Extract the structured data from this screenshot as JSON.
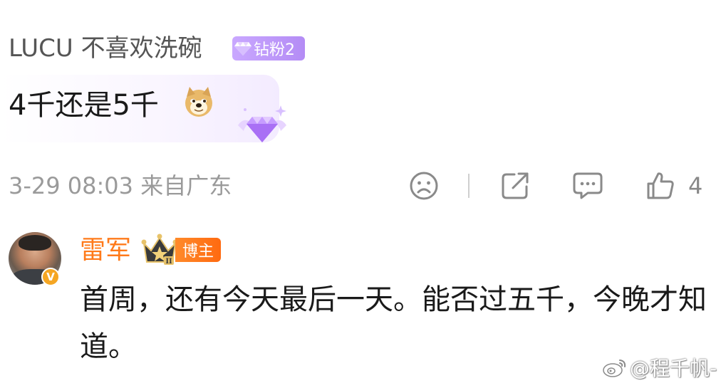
{
  "comment1": {
    "username": "LUCU 不喜欢洗碗",
    "badge_label": "钻粉2",
    "text": "4千还是5千",
    "timestamp": "3-29 08:03",
    "location": "来自广东",
    "like_count": "4",
    "icons": [
      "dislike-icon",
      "share-icon",
      "comment-icon",
      "like-icon"
    ]
  },
  "comment2": {
    "username": "雷军",
    "badge_label": "博主",
    "crown_level": "II",
    "verified_mark": "V",
    "text": "首周，还有今天最后一天。能否过五千，今晚才知道。"
  },
  "watermark": {
    "text": "@程千帆-"
  },
  "colors": {
    "accent_orange": "#ff7a1a",
    "badge_purple": "#b48cf5",
    "meta_gray": "#9a9a9a"
  }
}
